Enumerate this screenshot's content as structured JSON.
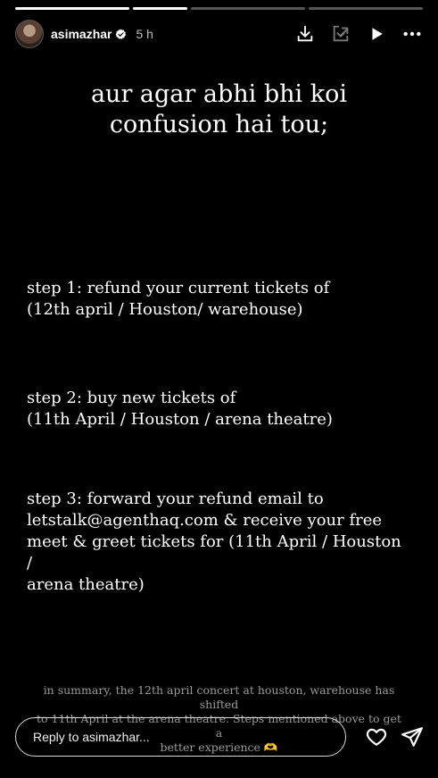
{
  "story": {
    "username": "asimazhar",
    "time": "5 h",
    "title_lines": [
      "aur agar abhi bhi koi",
      "confusion hai tou;"
    ],
    "steps": [
      [
        "step 1: refund your current tickets of",
        "(12th april / Houston/ warehouse)"
      ],
      [
        "step 2: buy new tickets of",
        "(11th April / Houston / arena theatre)"
      ],
      [
        "step 3: forward your refund email to",
        "letstalk@agenthaq.com & receive your free",
        "meet & greet tickets for (11th April / Houston /",
        "arena theatre)"
      ]
    ],
    "summary_lines": [
      "in summary, the 12th april concert at houston, warehouse has shifted",
      "to 11th April at the arena theatre. Steps mentioned above to get a",
      "better experience 🫶"
    ]
  },
  "reply": {
    "placeholder": "Reply to asimazhar..."
  },
  "icons": [
    "verified-icon",
    "download-icon",
    "add-to-story-icon",
    "play-icon",
    "more-icon",
    "heart-icon",
    "share-icon"
  ]
}
